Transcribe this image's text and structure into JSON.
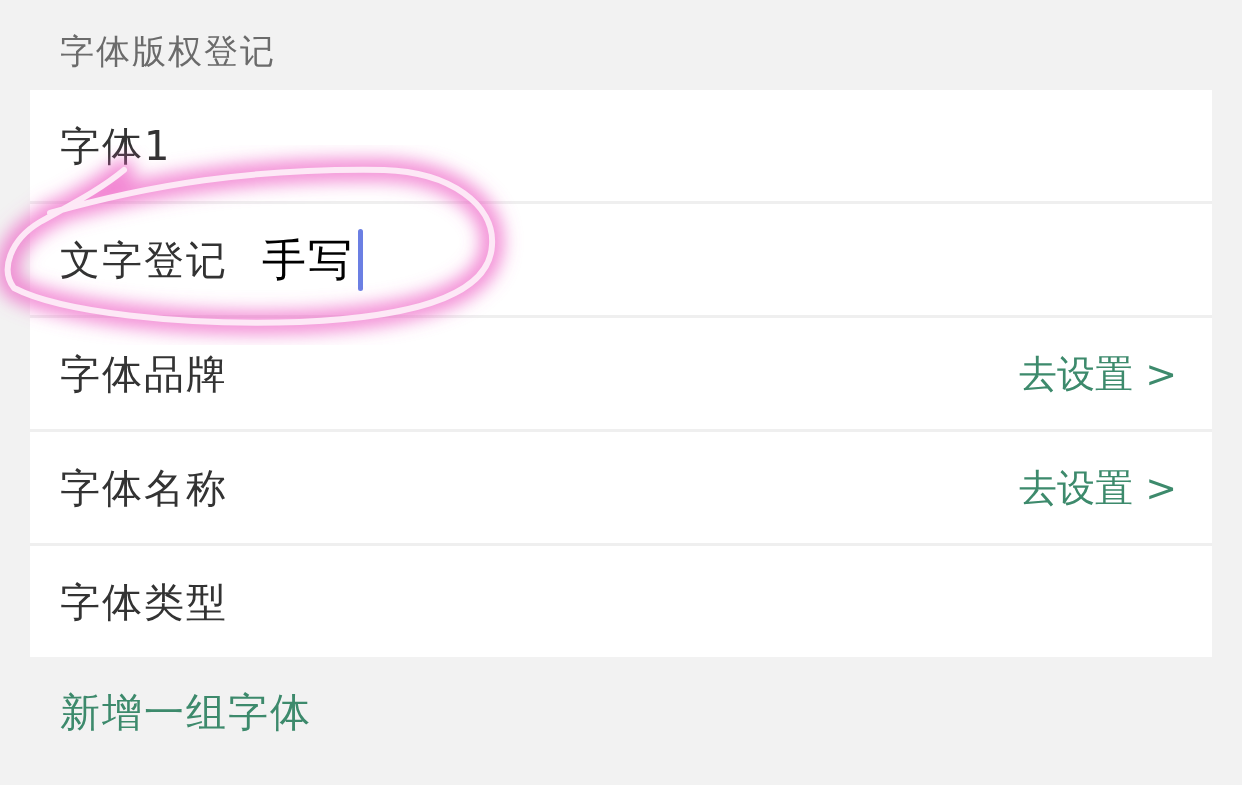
{
  "section_title": "字体版权登记",
  "rows": [
    {
      "kind": "plain",
      "label": "字体1"
    },
    {
      "kind": "input",
      "label": "文字登记",
      "value": "手写",
      "focused": true
    },
    {
      "kind": "link",
      "label": "字体品牌",
      "action": "去设置 >"
    },
    {
      "kind": "link",
      "label": "字体名称",
      "action": "去设置 >"
    },
    {
      "kind": "plain",
      "label": "字体类型"
    }
  ],
  "add_link": "新增一组字体"
}
